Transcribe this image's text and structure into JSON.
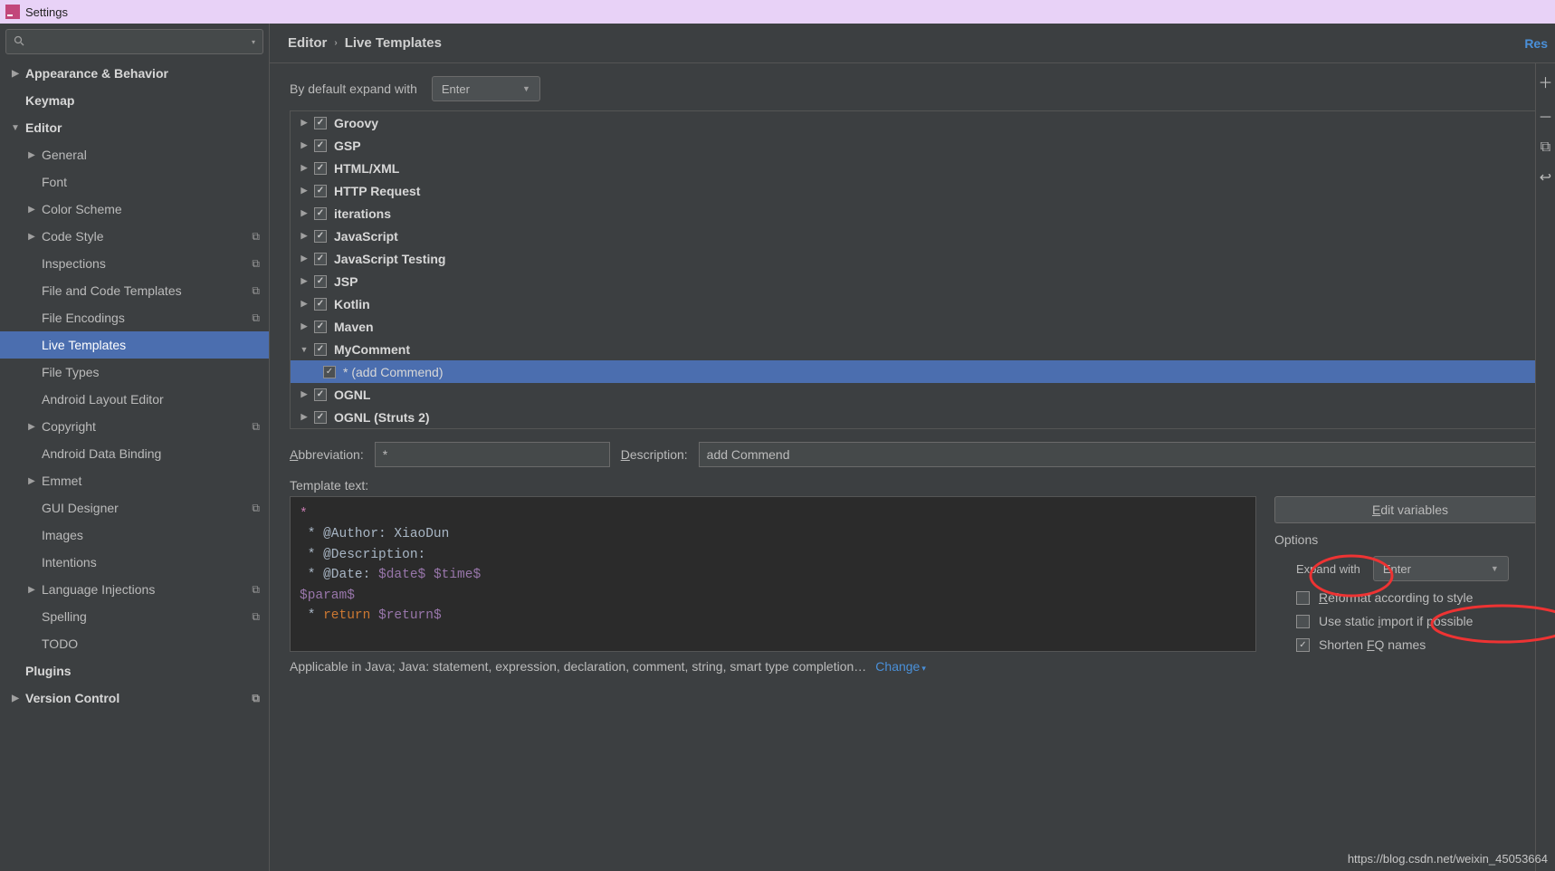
{
  "window_title": "Settings",
  "search_placeholder": "",
  "breadcrumb": {
    "a": "Editor",
    "b": "Live Templates"
  },
  "reset": "Res",
  "expand_default_label": "By default expand with",
  "expand_default_value": "Enter",
  "sidebar": {
    "items": [
      {
        "label": "Appearance & Behavior",
        "tri": "▶",
        "bold": true,
        "ind": 0
      },
      {
        "label": "Keymap",
        "tri": "",
        "bold": true,
        "ind": 0,
        "pad": 1
      },
      {
        "label": "Editor",
        "tri": "▼",
        "bold": true,
        "ind": 0
      },
      {
        "label": "General",
        "tri": "▶",
        "bold": false,
        "ind": 1
      },
      {
        "label": "Font",
        "tri": "",
        "bold": false,
        "ind": 1,
        "pad": 1
      },
      {
        "label": "Color Scheme",
        "tri": "▶",
        "bold": false,
        "ind": 1
      },
      {
        "label": "Code Style",
        "tri": "▶",
        "bold": false,
        "ind": 1,
        "copy": true
      },
      {
        "label": "Inspections",
        "tri": "",
        "bold": false,
        "ind": 1,
        "pad": 1,
        "copy": true
      },
      {
        "label": "File and Code Templates",
        "tri": "",
        "bold": false,
        "ind": 1,
        "pad": 1,
        "copy": true
      },
      {
        "label": "File Encodings",
        "tri": "",
        "bold": false,
        "ind": 1,
        "pad": 1,
        "copy": true
      },
      {
        "label": "Live Templates",
        "tri": "",
        "bold": false,
        "ind": 1,
        "pad": 1,
        "selected": true
      },
      {
        "label": "File Types",
        "tri": "",
        "bold": false,
        "ind": 1,
        "pad": 1
      },
      {
        "label": "Android Layout Editor",
        "tri": "",
        "bold": false,
        "ind": 1,
        "pad": 1
      },
      {
        "label": "Copyright",
        "tri": "▶",
        "bold": false,
        "ind": 1,
        "copy": true
      },
      {
        "label": "Android Data Binding",
        "tri": "",
        "bold": false,
        "ind": 1,
        "pad": 1
      },
      {
        "label": "Emmet",
        "tri": "▶",
        "bold": false,
        "ind": 1
      },
      {
        "label": "GUI Designer",
        "tri": "",
        "bold": false,
        "ind": 1,
        "pad": 1,
        "copy": true
      },
      {
        "label": "Images",
        "tri": "",
        "bold": false,
        "ind": 1,
        "pad": 1
      },
      {
        "label": "Intentions",
        "tri": "",
        "bold": false,
        "ind": 1,
        "pad": 1
      },
      {
        "label": "Language Injections",
        "tri": "▶",
        "bold": false,
        "ind": 1,
        "copy": true
      },
      {
        "label": "Spelling",
        "tri": "",
        "bold": false,
        "ind": 1,
        "pad": 1,
        "copy": true
      },
      {
        "label": "TODO",
        "tri": "",
        "bold": false,
        "ind": 1,
        "pad": 1
      },
      {
        "label": "Plugins",
        "tri": "",
        "bold": true,
        "ind": 0,
        "pad": 1
      },
      {
        "label": "Version Control",
        "tri": "▶",
        "bold": true,
        "ind": 0,
        "copy": true
      }
    ]
  },
  "tree": [
    {
      "label": "Groovy",
      "tri": "▶",
      "checked": true
    },
    {
      "label": "GSP",
      "tri": "▶",
      "checked": true
    },
    {
      "label": "HTML/XML",
      "tri": "▶",
      "checked": true
    },
    {
      "label": "HTTP Request",
      "tri": "▶",
      "checked": true
    },
    {
      "label": "iterations",
      "tri": "▶",
      "checked": true
    },
    {
      "label": "JavaScript",
      "tri": "▶",
      "checked": true
    },
    {
      "label": "JavaScript Testing",
      "tri": "▶",
      "checked": true
    },
    {
      "label": "JSP",
      "tri": "▶",
      "checked": true
    },
    {
      "label": "Kotlin",
      "tri": "▶",
      "checked": true
    },
    {
      "label": "Maven",
      "tri": "▶",
      "checked": true
    },
    {
      "label": "MyComment",
      "tri": "▼",
      "checked": true
    },
    {
      "label": "* (add Commend)",
      "tri": "",
      "checked": true,
      "child": true,
      "selected": true
    },
    {
      "label": "OGNL",
      "tri": "▶",
      "checked": true
    },
    {
      "label": "OGNL (Struts 2)",
      "tri": "▶",
      "checked": true
    }
  ],
  "abbr_label": "Abbreviation:",
  "abbr_value": "*",
  "desc_label": "Description:",
  "desc_value": "add Commend",
  "tmpl_label": "Template text:",
  "tmpl_html": "<span class='star-pink'>*</span>\n * @Author: XiaoDun\n * @Description: \n * @Date: <span class='var'>$date$</span> <span class='var'>$time$</span>\n<span class='var'>$param$</span>\n * <span class='kw-return'>return</span> <span class='var'>$return$</span>",
  "edit_vars": "Edit variables",
  "options_title": "Options",
  "expand_with_label": "Expand with",
  "expand_with_value": "Enter",
  "opts": {
    "reformat": {
      "checked": false,
      "label": "Reformat according to style"
    },
    "static": {
      "checked": false,
      "label": "Use static import if possible"
    },
    "shorten": {
      "checked": true,
      "label": "Shorten FQ names"
    }
  },
  "applicable": "Applicable in Java; Java: statement, expression, declaration, comment, string, smart type completion…",
  "change": "Change",
  "watermark": "https://blog.csdn.net/weixin_45053664",
  "abbr_ul": "A",
  "desc_ul": "D",
  "tmpl_ul": "T",
  "editvars_ul": "E",
  "expandwith_ul": "E",
  "reformat_ul": "R",
  "static_ul": "i",
  "shorten_ul": "F"
}
